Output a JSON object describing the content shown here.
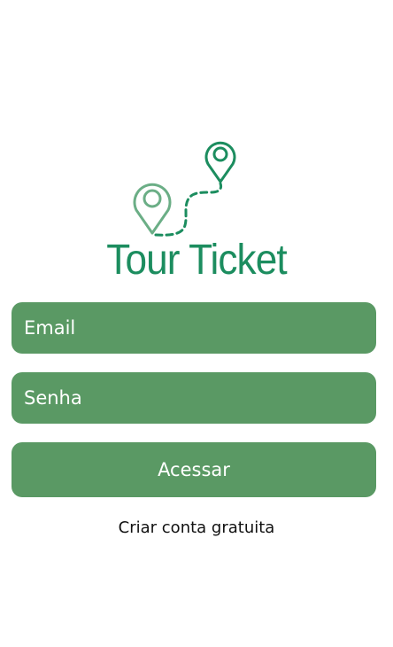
{
  "brand": {
    "title": "Tour Ticket",
    "logo_icon": "map-route-pins-icon",
    "color": "#1c8d5f"
  },
  "login_form": {
    "email_placeholder": "Email",
    "password_placeholder": "Senha",
    "submit_label": "Acessar",
    "signup_link": "Criar conta gratuita"
  },
  "colors": {
    "field_background": "#5a9964",
    "field_text": "#ffffff",
    "background": "#ffffff"
  }
}
